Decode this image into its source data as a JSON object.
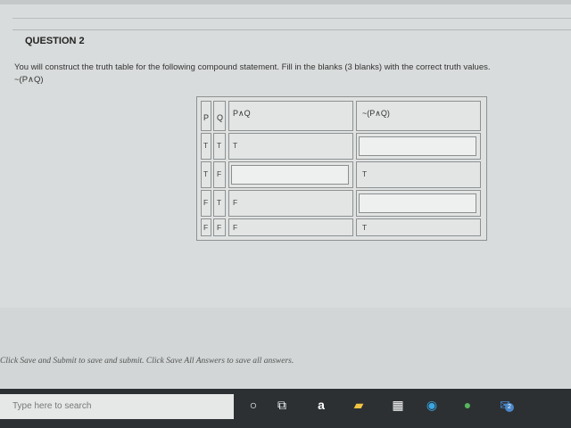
{
  "question": {
    "title": "QUESTION 2",
    "instructions": "You will construct the truth table for the following compound statement. Fill in the blanks (3 blanks) with the correct truth values.",
    "statement": "~(P∧Q)"
  },
  "table": {
    "headers": {
      "p": "P",
      "q": "Q",
      "pq": "P∧Q",
      "notpq": "~(P∧Q)"
    },
    "rows": [
      {
        "p": "T",
        "q": "T",
        "pq": "T",
        "notpq": ""
      },
      {
        "p": "T",
        "q": "F",
        "pq": "",
        "notpq": "T"
      },
      {
        "p": "F",
        "q": "T",
        "pq": "F",
        "notpq": ""
      },
      {
        "p": "F",
        "q": "F",
        "pq": "F",
        "notpq": "T"
      }
    ]
  },
  "footer": {
    "text": "Click Save and Submit to save and submit. Click Save All Answers to save all answers."
  },
  "taskbar": {
    "search_placeholder": "Type here to search",
    "badge": "2"
  }
}
